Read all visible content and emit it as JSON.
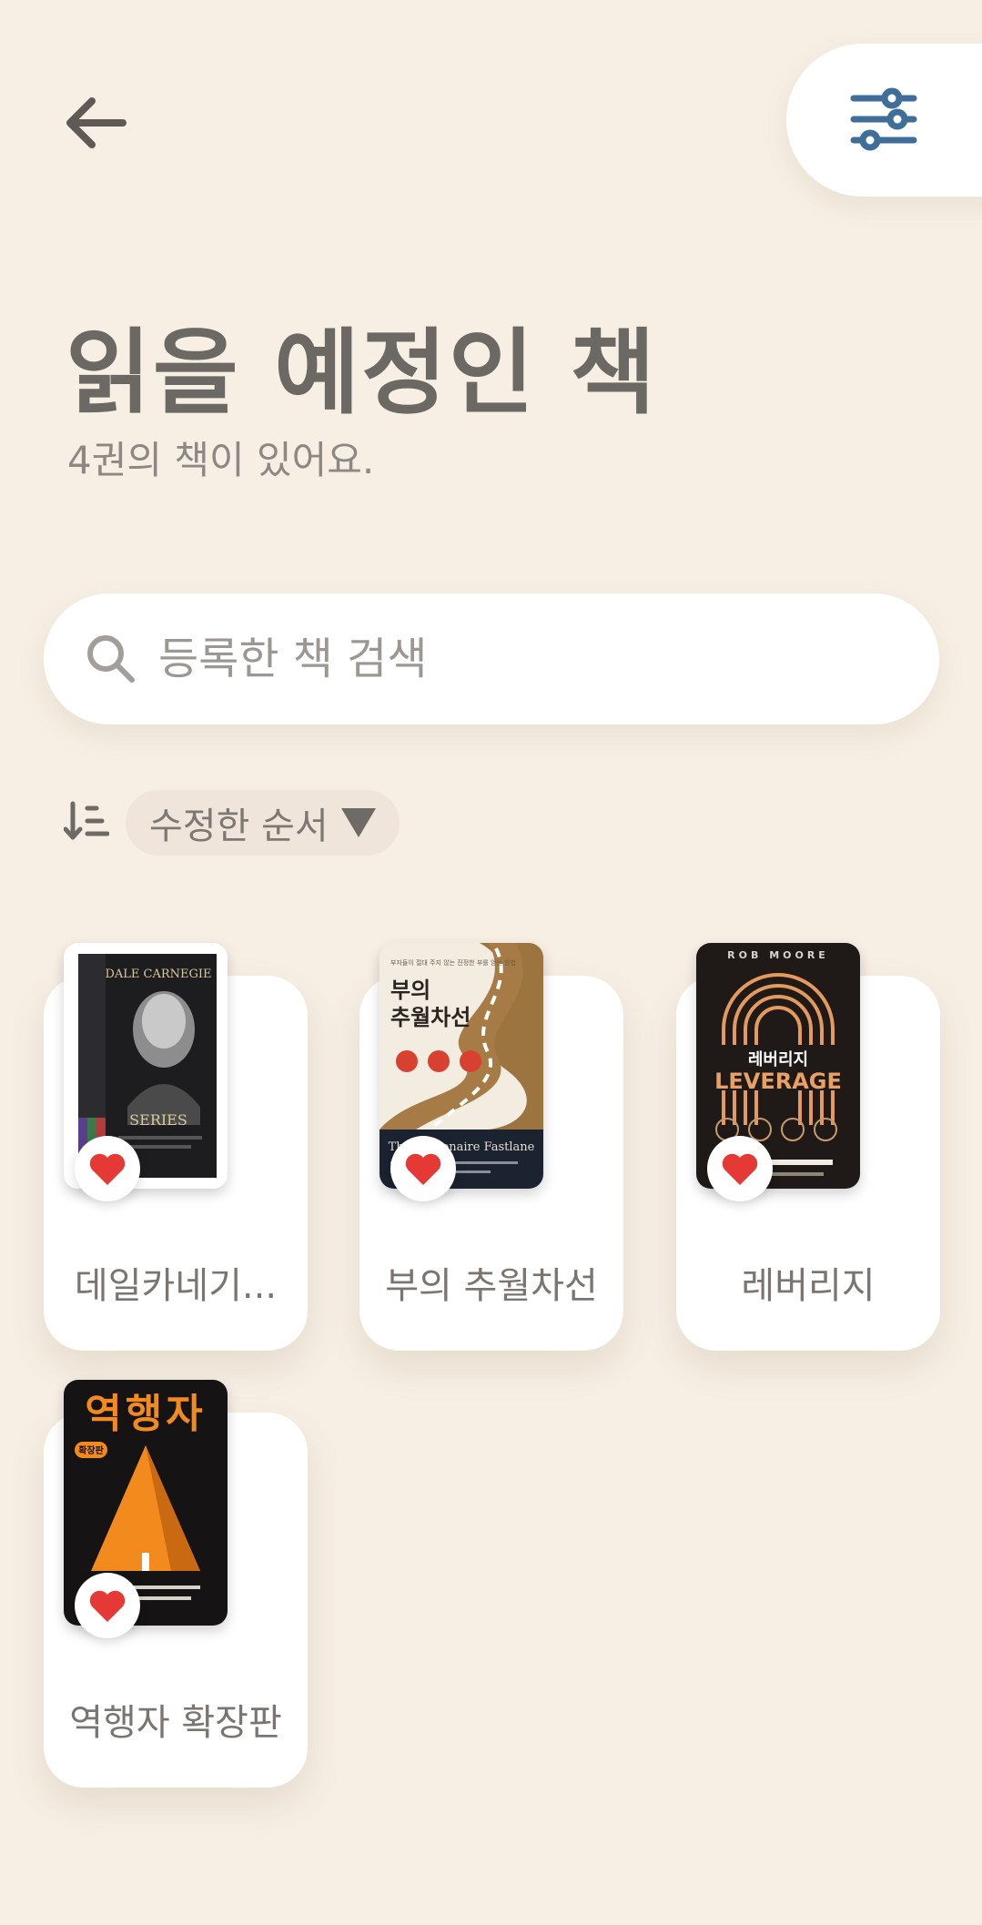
{
  "header": {
    "title": "읽을 예정인 책",
    "subtitle": "4권의 책이 있어요."
  },
  "search": {
    "placeholder": "등록한 책 검색"
  },
  "sort": {
    "label": "수정한 순서"
  },
  "books": [
    {
      "title": "데일카네기...",
      "favorite": true,
      "cover": {
        "top_text": "DALE CARNEGIE",
        "bottom_text": "SERIES"
      }
    },
    {
      "title": "부의 추월차선",
      "favorite": true,
      "cover": {
        "tagline": "부자들이 절대 주지 않는 진정한 부를 얻는 방법",
        "title_line1": "부의",
        "title_line2": "추월차선",
        "subtitle": "The Millionaire Fastlane"
      }
    },
    {
      "title": "레버리지",
      "favorite": true,
      "cover": {
        "author": "ROB MOORE",
        "title_kr": "레버리지",
        "title_en": "LEVERAGE"
      }
    },
    {
      "title": "역행자 확장판",
      "favorite": true,
      "cover": {
        "title_kr": "역행자",
        "edition": "확장판"
      }
    }
  ],
  "colors": {
    "background": "#f7efe4",
    "card": "#ffffff",
    "heart": "#e53935",
    "filter_icon": "#3f6f98",
    "chip": "#efe5da"
  }
}
